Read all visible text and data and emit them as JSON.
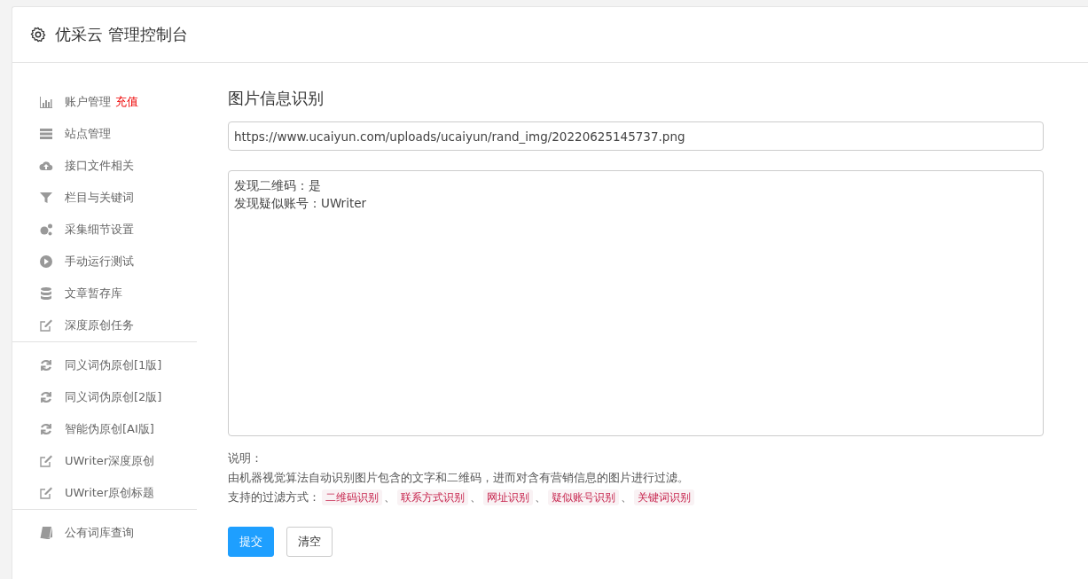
{
  "header": {
    "title": "优采云 管理控制台"
  },
  "sidebar": {
    "groups": [
      {
        "items": [
          {
            "label": "账户管理",
            "badge": "充值"
          },
          {
            "label": "站点管理"
          },
          {
            "label": "接口文件相关"
          },
          {
            "label": "栏目与关键词"
          },
          {
            "label": "采集细节设置"
          },
          {
            "label": "手动运行测试"
          },
          {
            "label": "文章暂存库"
          },
          {
            "label": "深度原创任务"
          }
        ]
      },
      {
        "items": [
          {
            "label": "同义词伪原创[1版]"
          },
          {
            "label": "同义词伪原创[2版]"
          },
          {
            "label": "智能伪原创[AI版]"
          },
          {
            "label": "UWriter深度原创"
          },
          {
            "label": "UWriter原创标题"
          }
        ]
      },
      {
        "items": [
          {
            "label": "公有词库查询"
          }
        ]
      }
    ]
  },
  "main": {
    "title": "图片信息识别",
    "url_field": {
      "value": "https://www.ucaiyun.com/uploads/ucaiyun/rand_img/20220625145737.png"
    },
    "result_box": {
      "lines": [
        "发现二维码：是",
        "发现疑似账号：UWriter"
      ]
    },
    "notes": {
      "heading": "说明：",
      "description": "由机器视觉算法自动识别图片包含的文字和二维码，进而对含有营销信息的图片进行过滤。",
      "methods_label": "支持的过滤方式：",
      "methods": [
        "二维码识别",
        "联系方式识别",
        "网址识别",
        "疑似账号识别",
        "关键词识别"
      ],
      "separator": "、"
    },
    "buttons": [
      {
        "label": "提交",
        "kind": "primary"
      },
      {
        "label": "清空",
        "kind": "default"
      }
    ]
  }
}
